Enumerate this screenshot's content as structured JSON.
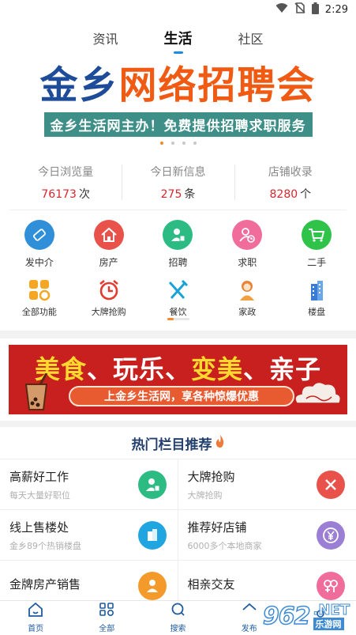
{
  "status_bar": {
    "time": "2:29"
  },
  "top_tabs": [
    {
      "label": "资讯"
    },
    {
      "label": "生活"
    },
    {
      "label": "社区"
    }
  ],
  "banner": {
    "title_part1": "金乡",
    "title_part2": "网络招聘会",
    "subtitle": "金乡生活网主办！免费提供招聘求职服务",
    "dots": 4,
    "active_dot": 0
  },
  "stats": [
    {
      "label": "今日浏览量",
      "value": "76173",
      "unit": "次"
    },
    {
      "label": "今日新信息",
      "value": "275",
      "unit": "条"
    },
    {
      "label": "店铺收录",
      "value": "8280",
      "unit": "个"
    }
  ],
  "grid1": [
    {
      "label": "发中介",
      "icon": "pencil-icon",
      "color": "#2f8fd8"
    },
    {
      "label": "房产",
      "icon": "house-icon",
      "color": "#e8524a"
    },
    {
      "label": "招聘",
      "icon": "recruit-user-icon",
      "color": "#2dbb84"
    },
    {
      "label": "求职",
      "icon": "job-seeker-icon",
      "color": "#f06c9a"
    },
    {
      "label": "二手",
      "icon": "cart-icon",
      "color": "#2fc34a"
    }
  ],
  "grid2": [
    {
      "label": "全部功能",
      "icon": "grid-icon"
    },
    {
      "label": "大牌抢购",
      "icon": "alarm-clock-icon"
    },
    {
      "label": "餐饮",
      "icon": "fork-knife-icon"
    },
    {
      "label": "家政",
      "icon": "housekeeper-icon"
    },
    {
      "label": "楼盘",
      "icon": "building-icon"
    }
  ],
  "promo": {
    "w1": "美食",
    "sep1": "、",
    "w2": "玩乐",
    "sep2": "、",
    "w3": "变美",
    "sep3": "、",
    "w4": "亲子",
    "pill": "上金乡生活网，享各种惊爆优惠"
  },
  "hot": {
    "title": "热门栏目推荐",
    "items": [
      {
        "name": "高薪好工作",
        "desc": "每天大量好职位",
        "icon": "recruit-user-icon",
        "color": "#2dbb84"
      },
      {
        "name": "大牌抢购",
        "desc": "大牌抢购",
        "icon": "fork-knife-icon",
        "color": "#e8524a"
      },
      {
        "name": "线上售楼处",
        "desc": "金乡89个热销楼盘",
        "icon": "building-icon",
        "color": "#1fa6e0"
      },
      {
        "name": "推荐好店铺",
        "desc": "6000多个本地商家",
        "icon": "yen-icon",
        "color": "#9b7fd4"
      },
      {
        "name": "金牌房产销售",
        "desc": "",
        "icon": "agent-icon",
        "color": "#f39a2a"
      },
      {
        "name": "相亲交友",
        "desc": "",
        "icon": "couple-icon",
        "color": "#f06c9a"
      }
    ]
  },
  "bottom_nav": [
    {
      "label": "首页",
      "icon": "home-icon"
    },
    {
      "label": "全部",
      "icon": "all-grid-icon"
    },
    {
      "label": "搜索",
      "icon": "search-icon"
    },
    {
      "label": "发布",
      "icon": "publish-icon"
    },
    {
      "label": "",
      "icon": "me-icon"
    }
  ],
  "watermark": {
    "num": "962",
    "net": ".NET",
    "cn": "乐游网"
  }
}
